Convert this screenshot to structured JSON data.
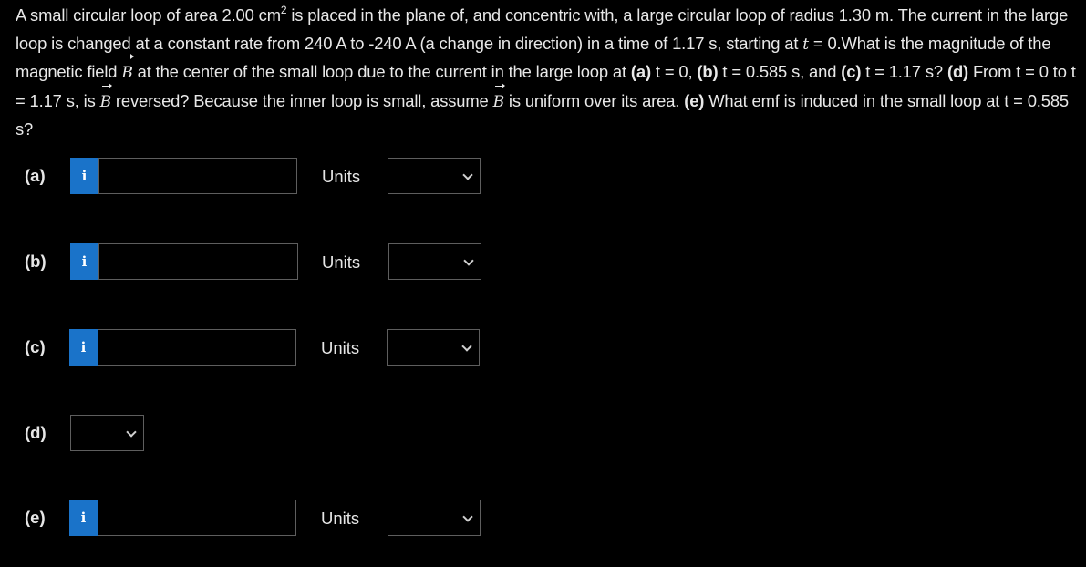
{
  "question": {
    "t1": "A small circular loop of area 2.00 cm",
    "sup": "2",
    "t2": " is placed in the plane of, and concentric with, a large circular loop of radius 1.30 m. The current in the large loop is changed at a constant rate from 240 A to -240 A (a change in direction) in a time of 1.17 s, starting at ",
    "t_var": "t",
    "t3": " = 0.What is the magnitude of the magnetic field ",
    "vec_b": "B",
    "t4": " at the center of the small loop due to the current in the large loop at ",
    "a_label": "(a)",
    "t5": " t = 0, ",
    "b_label": "(b)",
    "t6": " t = 0.585 s, and ",
    "c_label": "(c)",
    "t7": " t = 1.17 s? ",
    "d_label": "(d)",
    "t8": " From t = 0 to t = 1.17 s, is ",
    "t9": " reversed? Because the inner loop is small, assume ",
    "t10": " is uniform over its area. ",
    "e_label": "(e)",
    "t11": " What emf is induced in the small loop at t = 0.585 s?"
  },
  "parts": {
    "a": {
      "label": "(a)",
      "info_icon": "i",
      "value": "",
      "units_label": "Units",
      "units_selected": ""
    },
    "b": {
      "label": "(b)",
      "info_icon": "i",
      "value": "",
      "units_label": "Units",
      "units_selected": ""
    },
    "c": {
      "label": "(c)",
      "info_icon": "i",
      "value": "",
      "units_label": "Units",
      "units_selected": ""
    },
    "d": {
      "label": "(d)",
      "selected": ""
    },
    "e": {
      "label": "(e)",
      "info_icon": "i",
      "value": "",
      "units_label": "Units",
      "units_selected": ""
    }
  },
  "colors": {
    "background": "#000000",
    "text": "#e6e6e6",
    "info_button": "#1a73c9",
    "input_border": "#5e5e5e"
  }
}
